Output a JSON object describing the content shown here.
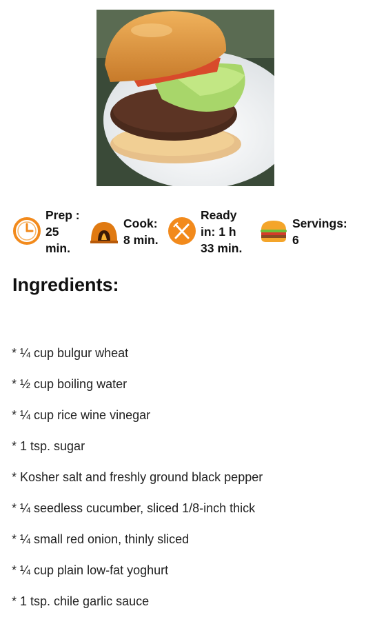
{
  "recipe_image": {
    "alt": "burger-photo"
  },
  "stats": [
    {
      "icon": "clock-icon",
      "label": "Prep :\n25\nmin."
    },
    {
      "icon": "oven-icon",
      "label": "Cook:\n8 min."
    },
    {
      "icon": "fork-knife-icon",
      "label": "Ready\nin: 1 h\n33 min."
    },
    {
      "icon": "burger-icon",
      "label": "Servings:\n6"
    }
  ],
  "ingredients_heading": "Ingredients:",
  "ingredients": [
    "* ¼ cup bulgur wheat",
    "* ½ cup boiling water",
    "* ¼ cup rice wine vinegar",
    "* 1 tsp. sugar",
    "* Kosher salt and freshly ground black pepper",
    "* ¼ seedless cucumber, sliced 1/8-inch thick",
    "* ¼ small red onion, thinly sliced",
    "* ¼ cup plain low-fat yoghurt",
    "* 1 tsp. chile garlic sauce"
  ],
  "colors": {
    "accent_orange": "#f28a1c",
    "text": "#111111"
  }
}
